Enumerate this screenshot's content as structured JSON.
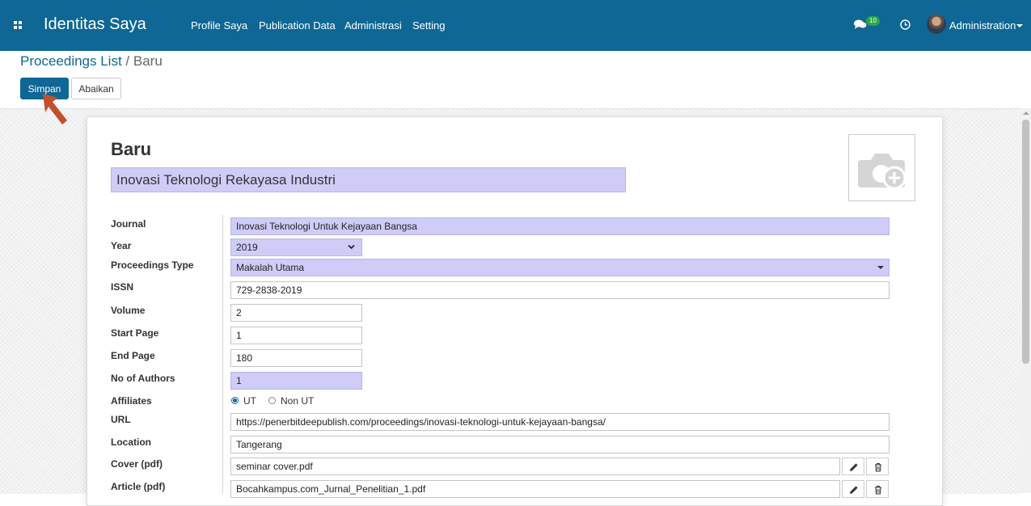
{
  "navbar": {
    "brand": "Identitas Saya",
    "menu": [
      "Profile Saya",
      "Publication Data",
      "Administrasi",
      "Setting"
    ],
    "chat_count": "10",
    "user_name": "Administration",
    "icons": [
      "apps-grid-icon",
      "chat-icon",
      "clock-icon",
      "avatar"
    ]
  },
  "breadcrumb": {
    "parent": "Proceedings List",
    "separator": "/",
    "current": "Baru"
  },
  "buttons": {
    "save": "Simpan",
    "discard": "Abaikan"
  },
  "form": {
    "title": "Baru",
    "name": "Inovasi Teknologi Rekayasa Industri",
    "labels": {
      "journal": "Journal",
      "year": "Year",
      "proceedings_type": "Proceedings Type",
      "issn": "ISSN",
      "volume": "Volume",
      "start_page": "Start Page",
      "end_page": "End Page",
      "no_of_authors": "No of Authors",
      "affiliates": "Affiliates",
      "url": "URL",
      "location": "Location",
      "cover": "Cover (pdf)",
      "article": "Article (pdf)"
    },
    "values": {
      "journal": "Inovasi Teknologi Untuk Kejayaan Bangsa",
      "year": "2019",
      "proceedings_type": "Makalah Utama",
      "issn": "729-2838-2019",
      "volume": "2",
      "start_page": "1",
      "end_page": "180",
      "no_of_authors": "1",
      "url": "https://penerbitdeepublish.com/proceedings/inovasi-teknologi-untuk-kejayaan-bangsa/",
      "location": "Tangerang",
      "cover": "seminar cover.pdf",
      "article": "Bocahkampus.com_Jurnal_Penelitian_1.pdf"
    },
    "affiliates_options": [
      "UT",
      "Non UT"
    ],
    "affiliates_selected": "UT"
  },
  "colors": {
    "navbar": "#0e6794",
    "required_field": "#cfcdf7",
    "pointer_arrow": "#c0502e"
  }
}
